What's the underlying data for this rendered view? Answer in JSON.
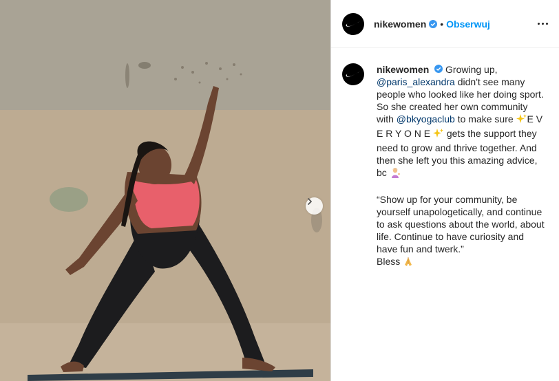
{
  "post": {
    "username": "nikewomen",
    "follow_label": "Obserwuj",
    "separator": "•",
    "caption": {
      "username": "nikewomen",
      "part1": "Growing up,",
      "mention1": "@paris_alexandra",
      "part2": " didn't see many people who looked like her doing sport. So she created her own community with ",
      "mention2": "@bkyogaclub",
      "part3": " to make sure ",
      "everyone": "E V E R Y O N E",
      "part4": " gets the support they need to grow and thrive together. And then she left you this amazing advice, bc ",
      "quote": "“Show up for your community, be yourself unapologetically, and continue to ask questions about the world, about life. Continue to have curiosity and have fun and twerk.”",
      "bless": "Bless "
    }
  },
  "icons": {
    "logo": "nike-swoosh-icon",
    "verified": "verified-badge-icon",
    "more": "more-options-icon",
    "next": "chevron-right-icon",
    "sparkles": "sparkles-emoji",
    "shrug": "person-tipping-hand-emoji",
    "pray": "folded-hands-emoji"
  },
  "colors": {
    "follow": "#0095f6",
    "mention": "#00376b",
    "verified": "#3897f0",
    "bra": "#e8606b"
  }
}
